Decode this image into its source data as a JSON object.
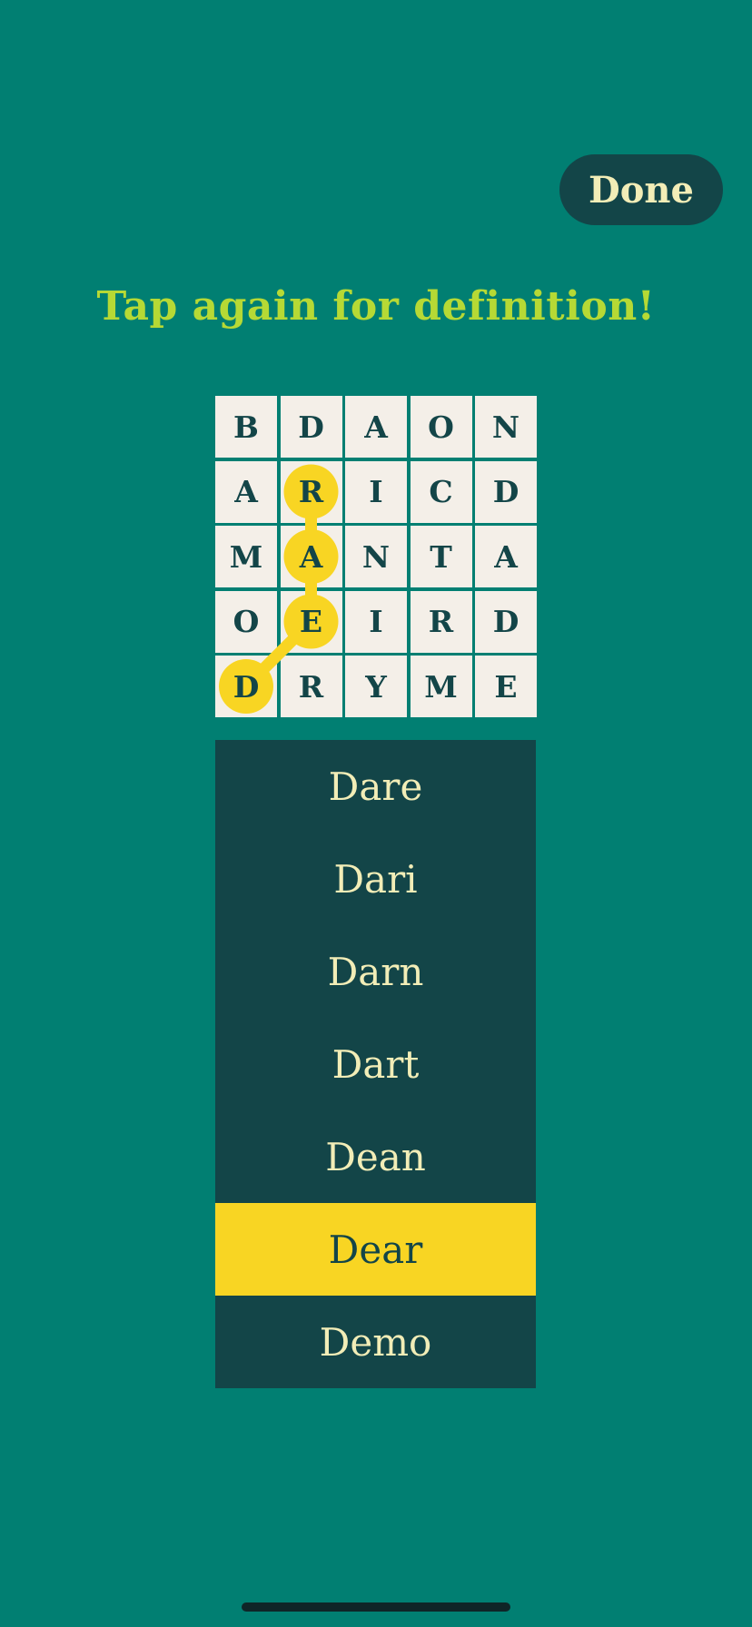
{
  "header": {
    "done_label": "Done"
  },
  "hint": {
    "text": "Tap again for definition!"
  },
  "board": {
    "rows": [
      [
        "B",
        "D",
        "A",
        "O",
        "N"
      ],
      [
        "A",
        "R",
        "I",
        "C",
        "D"
      ],
      [
        "M",
        "A",
        "N",
        "T",
        "A"
      ],
      [
        "O",
        "E",
        "I",
        "R",
        "D"
      ],
      [
        "D",
        "R",
        "Y",
        "M",
        "E"
      ]
    ],
    "highlighted_path": [
      [
        4,
        0
      ],
      [
        3,
        1
      ],
      [
        2,
        1
      ],
      [
        1,
        1
      ]
    ]
  },
  "words": [
    {
      "label": "Dare",
      "selected": false
    },
    {
      "label": "Dari",
      "selected": false
    },
    {
      "label": "Darn",
      "selected": false
    },
    {
      "label": "Dart",
      "selected": false
    },
    {
      "label": "Dean",
      "selected": false
    },
    {
      "label": "Dear",
      "selected": true
    },
    {
      "label": "Demo",
      "selected": false
    }
  ],
  "colors": {
    "background": "#017F72",
    "dark": "#134548",
    "highlight": "#F8D523",
    "hint_text": "#B6D935",
    "light_text": "#F2EDB7",
    "tile": "#F4EFE8"
  }
}
